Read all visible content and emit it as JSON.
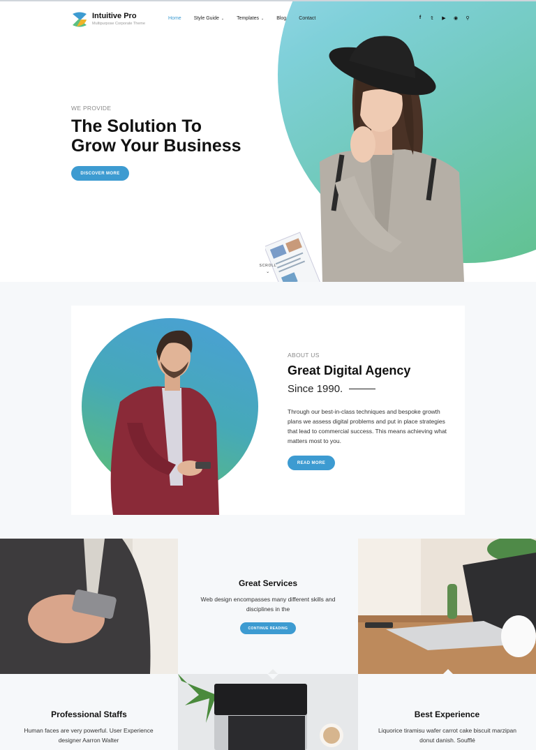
{
  "header": {
    "brand": "Intuitive Pro",
    "tagline": "Multipurpose Corporate Theme",
    "nav": [
      {
        "label": "Home",
        "active": true
      },
      {
        "label": "Style Guide",
        "dropdown": true
      },
      {
        "label": "Templates",
        "dropdown": true
      },
      {
        "label": "Blog"
      },
      {
        "label": "Contact"
      }
    ],
    "socials": [
      "facebook-icon",
      "twitter-icon",
      "youtube-icon",
      "wordpress-icon",
      "search-icon"
    ]
  },
  "hero": {
    "eyebrow": "WE PROVIDE",
    "title_line1": "The Solution To",
    "title_line2": "Grow Your Business",
    "button": "DISCOVER MORE",
    "scroll": "SCROLL"
  },
  "about": {
    "eyebrow": "ABOUT US",
    "title": "Great Digital Agency",
    "since": "Since 1990.",
    "body": "Through our best-in-class techniques and bespoke growth plans we assess digital problems and put in place strategies that lead to commercial success. This means achieving what matters most to you.",
    "button": "READ MORE"
  },
  "services": [
    {
      "title": "Great Services",
      "body": "Web design encompasses many different skills and disciplines in the",
      "button": "CONTINUE READING"
    },
    {
      "title": "Professional Staffs",
      "body": "Human faces are very powerful. User Experience designer Aarron Walter"
    },
    {
      "title": "Best Experience",
      "body": "Liquorice tiramisu wafer carrot cake biscuit marzipan donut danish. Soufflé"
    }
  ],
  "colors": {
    "accent": "#3d9bd1",
    "gradient_start": "#a9dcf2",
    "gradient_end": "#5cbf82"
  }
}
